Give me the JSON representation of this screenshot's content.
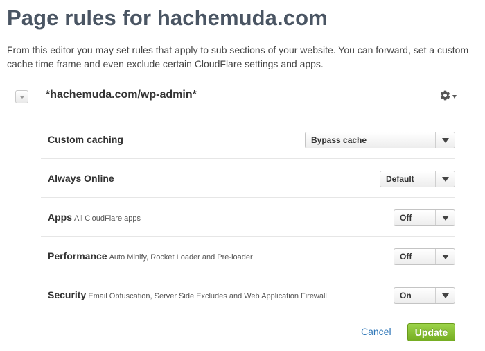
{
  "page": {
    "title": "Page rules for hachemuda.com",
    "intro": "From this editor you may set rules that apply to sub sections of your website. You can forward, set a custom cache time frame and even exclude certain CloudFlare settings and apps."
  },
  "rule": {
    "url_pattern": "*hachemuda.com/wp-admin*",
    "collapse_icon": "collapse-triangle-icon",
    "settings_icon": "gear-icon"
  },
  "settings": [
    {
      "name": "Custom caching",
      "description": "",
      "value": "Bypass cache"
    },
    {
      "name": "Always Online",
      "description": "",
      "value": "Default"
    },
    {
      "name": "Apps",
      "description": "All CloudFlare apps",
      "value": "Off"
    },
    {
      "name": "Performance",
      "description": "Auto Minify, Rocket Loader and Pre-loader",
      "value": "Off"
    },
    {
      "name": "Security",
      "description": "Email Obfuscation, Server Side Excludes and Web Application Firewall",
      "value": "On"
    }
  ],
  "actions": {
    "cancel_label": "Cancel",
    "update_label": "Update"
  },
  "colors": {
    "title": "#4a5563",
    "link": "#2f77b8",
    "update_button": "#80b829"
  }
}
